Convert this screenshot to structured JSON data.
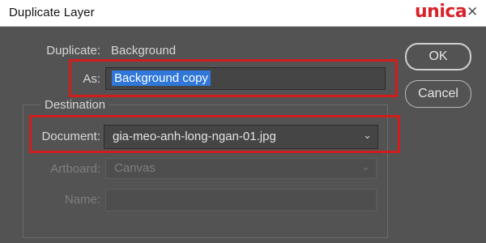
{
  "window": {
    "title": "Duplicate Layer",
    "watermark": "unica",
    "close_glyph": "✕"
  },
  "form": {
    "duplicate_label": "Duplicate:",
    "duplicate_value": "Background",
    "as_label": "As:",
    "as_value": "Background copy",
    "destination_title": "Destination",
    "document_label": "Document:",
    "document_value": "gia-meo-anh-long-ngan-01.jpg",
    "artboard_label": "Artboard:",
    "artboard_value": "Canvas",
    "name_label": "Name:",
    "name_value": ""
  },
  "buttons": {
    "ok": "OK",
    "cancel": "Cancel"
  },
  "icons": {
    "dropdown": "chevron-down-icon",
    "close": "close-icon"
  },
  "colors": {
    "dialog_bg": "#535353",
    "selection": "#2f77d9",
    "highlight_annotation": "#d11c1c",
    "logo": "#d8222a"
  }
}
